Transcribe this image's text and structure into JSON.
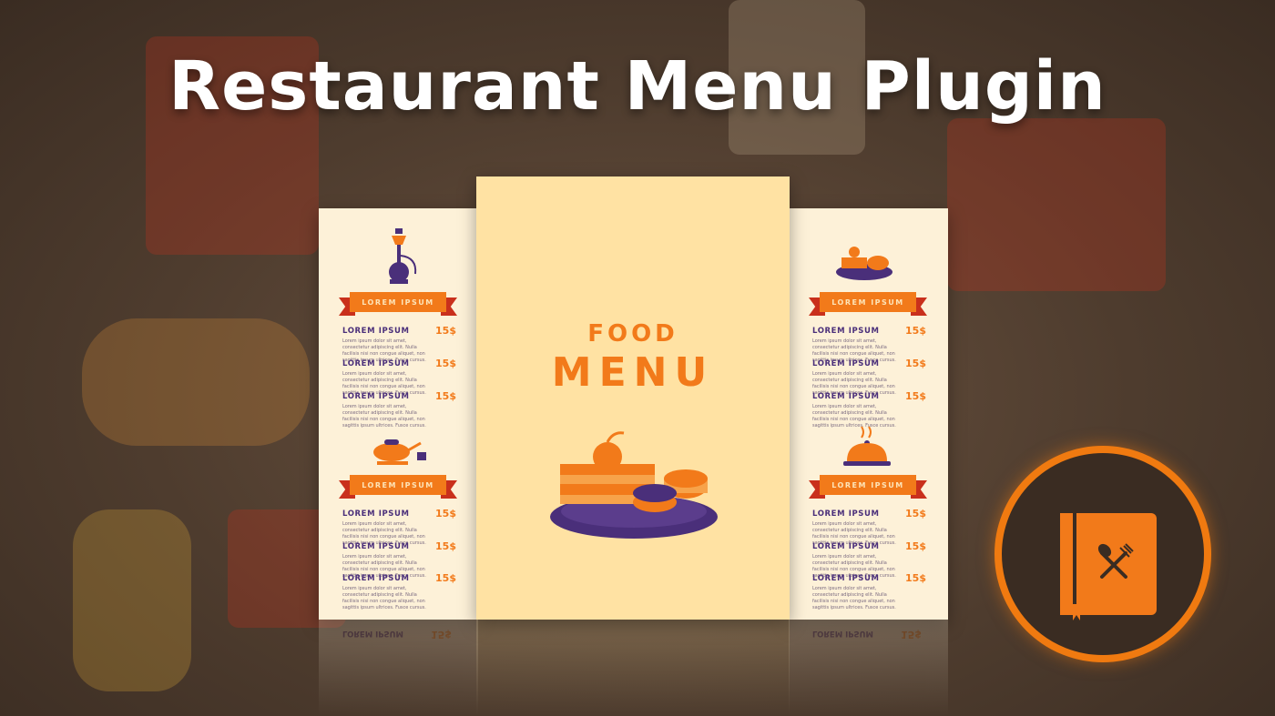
{
  "title": "Restaurant Menu Plugin",
  "center_menu": {
    "line1": "FOOD",
    "line2": "MENU"
  },
  "ribbon_label": "LOREM IPSUM",
  "item_name": "LOREM IPSUM",
  "item_price": "15$",
  "item_desc": "Lorem ipsum dolor sit amet, consectetur adipiscing elit. Nulla facilisis nisi non congue aliquet, non sagittis ipsum ultrices. Fusce cursus.",
  "reflection": {
    "name": "LOREM IPSUM",
    "price": "15$"
  },
  "colors": {
    "orange": "#f27a1a",
    "purple": "#4a2f7a",
    "cream": "#fdf1d8",
    "center": "#ffe2a3",
    "badge_ring": "#f07a10"
  },
  "icons": [
    "hookah-icon",
    "tea-pot-icon",
    "dessert-plate-icon",
    "cloche-icon",
    "cake-plate-icon",
    "menu-book-icon",
    "fork-spoon-icon"
  ]
}
